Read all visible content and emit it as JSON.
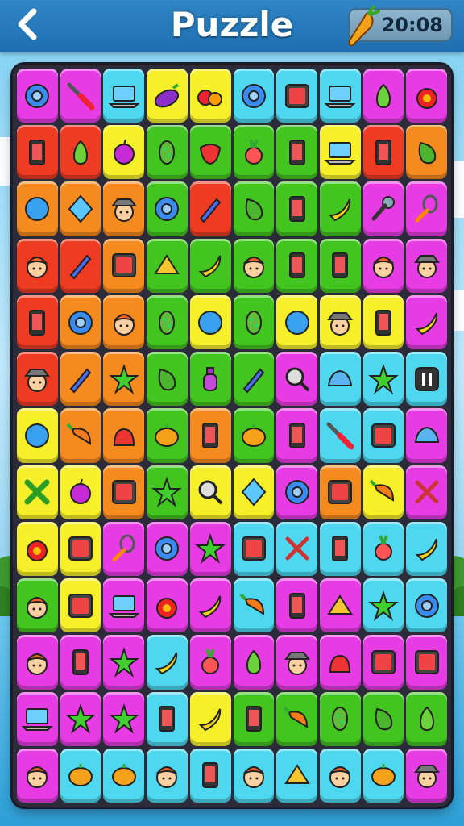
{
  "header": {
    "back_icon": "back-arrow-icon",
    "title": "Puzzle",
    "timer_icon": "carrot-icon",
    "timer": "20:08"
  },
  "colors": {
    "magenta": "#e73ce3",
    "cyan": "#4ed8f0",
    "yellow": "#f6f02a",
    "green": "#43c51f",
    "red": "#ee3b22",
    "orange": "#f58a1e",
    "lime": "#9be53a"
  },
  "board": {
    "rows": [
      [
        {
          "c": "magenta",
          "i": "ring-icon"
        },
        {
          "c": "magenta",
          "i": "screwdriver-icon"
        },
        {
          "c": "cyan",
          "i": "laptop-icon"
        },
        {
          "c": "yellow",
          "i": "eggplant-icon"
        },
        {
          "c": "yellow",
          "i": "fruit-pair-icon"
        },
        {
          "c": "cyan",
          "i": "ring-icon"
        },
        {
          "c": "cyan",
          "i": "tablet-icon"
        },
        {
          "c": "cyan",
          "i": "laptop-icon"
        },
        {
          "c": "magenta",
          "i": "pear-icon"
        },
        {
          "c": "magenta",
          "i": "tomato-icon"
        }
      ],
      [
        {
          "c": "red",
          "i": "phone-icon"
        },
        {
          "c": "red",
          "i": "pear-icon"
        },
        {
          "c": "yellow",
          "i": "plum-icon"
        },
        {
          "c": "green",
          "i": "pickle-icon"
        },
        {
          "c": "green",
          "i": "strawberry-icon"
        },
        {
          "c": "green",
          "i": "radish-icon"
        },
        {
          "c": "green",
          "i": "phone-icon"
        },
        {
          "c": "yellow",
          "i": "laptop-icon"
        },
        {
          "c": "red",
          "i": "phone-icon"
        },
        {
          "c": "orange",
          "i": "pepper-icon"
        }
      ],
      [
        {
          "c": "orange",
          "i": "ball-icon"
        },
        {
          "c": "orange",
          "i": "diamond-icon"
        },
        {
          "c": "orange",
          "i": "face-hat-icon"
        },
        {
          "c": "green",
          "i": "ring-icon"
        },
        {
          "c": "red",
          "i": "pencil-icon"
        },
        {
          "c": "green",
          "i": "pepper-icon"
        },
        {
          "c": "green",
          "i": "phone-icon"
        },
        {
          "c": "green",
          "i": "banana-icon"
        },
        {
          "c": "magenta",
          "i": "microphone-icon"
        },
        {
          "c": "magenta",
          "i": "whisk-icon"
        }
      ],
      [
        {
          "c": "red",
          "i": "face-icon"
        },
        {
          "c": "red",
          "i": "pencil-icon"
        },
        {
          "c": "orange",
          "i": "tablet-icon"
        },
        {
          "c": "green",
          "i": "cheese-icon"
        },
        {
          "c": "green",
          "i": "banana-icon"
        },
        {
          "c": "green",
          "i": "face-icon"
        },
        {
          "c": "green",
          "i": "phone-icon"
        },
        {
          "c": "green",
          "i": "phone-icon"
        },
        {
          "c": "magenta",
          "i": "face-icon"
        },
        {
          "c": "magenta",
          "i": "face-hat-icon"
        }
      ],
      [
        {
          "c": "red",
          "i": "phone-icon"
        },
        {
          "c": "orange",
          "i": "ring-icon"
        },
        {
          "c": "orange",
          "i": "face-icon"
        },
        {
          "c": "green",
          "i": "pickle-icon"
        },
        {
          "c": "yellow",
          "i": "ball-icon"
        },
        {
          "c": "green",
          "i": "pickle-icon"
        },
        {
          "c": "yellow",
          "i": "ball-icon"
        },
        {
          "c": "yellow",
          "i": "face-hat-icon"
        },
        {
          "c": "yellow",
          "i": "phone-icon"
        },
        {
          "c": "magenta",
          "i": "banana-icon"
        }
      ],
      [
        {
          "c": "red",
          "i": "face-hat-icon"
        },
        {
          "c": "orange",
          "i": "pencil-icon"
        },
        {
          "c": "orange",
          "i": "star-icon"
        },
        {
          "c": "green",
          "i": "pepper-icon"
        },
        {
          "c": "green",
          "i": "bottle-icon"
        },
        {
          "c": "green",
          "i": "pencil-icon"
        },
        {
          "c": "magenta",
          "i": "magnifier-icon"
        },
        {
          "c": "cyan",
          "i": "blob-icon"
        },
        {
          "c": "cyan",
          "i": "star-icon"
        },
        {
          "c": "cyan",
          "i": "pause-icon"
        }
      ],
      [
        {
          "c": "yellow",
          "i": "ball-icon"
        },
        {
          "c": "orange",
          "i": "carrot-icon"
        },
        {
          "c": "orange",
          "i": "bag-icon"
        },
        {
          "c": "green",
          "i": "pumpkin-icon"
        },
        {
          "c": "orange",
          "i": "phone-icon"
        },
        {
          "c": "green",
          "i": "pumpkin-icon"
        },
        {
          "c": "magenta",
          "i": "phone-icon"
        },
        {
          "c": "cyan",
          "i": "screwdriver-icon"
        },
        {
          "c": "cyan",
          "i": "tablet-icon"
        },
        {
          "c": "magenta",
          "i": "blob-icon"
        }
      ],
      [
        {
          "c": "yellow",
          "i": "cross-icon"
        },
        {
          "c": "yellow",
          "i": "plum-icon"
        },
        {
          "c": "orange",
          "i": "tablet-icon"
        },
        {
          "c": "green",
          "i": "star-icon"
        },
        {
          "c": "yellow",
          "i": "magnifier-icon"
        },
        {
          "c": "yellow",
          "i": "diamond-icon"
        },
        {
          "c": "magenta",
          "i": "ring-icon"
        },
        {
          "c": "orange",
          "i": "tablet-icon"
        },
        {
          "c": "yellow",
          "i": "carrot-icon"
        },
        {
          "c": "magenta",
          "i": "tools-icon"
        }
      ],
      [
        {
          "c": "yellow",
          "i": "tomato-icon"
        },
        {
          "c": "yellow",
          "i": "tablet-icon"
        },
        {
          "c": "magenta",
          "i": "whisk-icon"
        },
        {
          "c": "magenta",
          "i": "ring-icon"
        },
        {
          "c": "magenta",
          "i": "star-icon"
        },
        {
          "c": "cyan",
          "i": "tablet-icon"
        },
        {
          "c": "cyan",
          "i": "tools-icon"
        },
        {
          "c": "cyan",
          "i": "phone-icon"
        },
        {
          "c": "cyan",
          "i": "radish-icon"
        },
        {
          "c": "cyan",
          "i": "banana-icon"
        }
      ],
      [
        {
          "c": "green",
          "i": "face-icon"
        },
        {
          "c": "yellow",
          "i": "tablet-icon"
        },
        {
          "c": "magenta",
          "i": "laptop-icon"
        },
        {
          "c": "magenta",
          "i": "tomato-icon"
        },
        {
          "c": "magenta",
          "i": "banana-icon"
        },
        {
          "c": "cyan",
          "i": "carrot-icon"
        },
        {
          "c": "magenta",
          "i": "phone-icon"
        },
        {
          "c": "magenta",
          "i": "cheese-icon"
        },
        {
          "c": "cyan",
          "i": "star-icon"
        },
        {
          "c": "cyan",
          "i": "ring-icon"
        }
      ],
      [
        {
          "c": "magenta",
          "i": "face-icon"
        },
        {
          "c": "magenta",
          "i": "phone-icon"
        },
        {
          "c": "magenta",
          "i": "star-icon"
        },
        {
          "c": "cyan",
          "i": "banana-icon"
        },
        {
          "c": "magenta",
          "i": "radish-icon"
        },
        {
          "c": "magenta",
          "i": "pear-icon"
        },
        {
          "c": "magenta",
          "i": "face-hat-icon"
        },
        {
          "c": "magenta",
          "i": "bag-icon"
        },
        {
          "c": "magenta",
          "i": "tablet-icon"
        },
        {
          "c": "magenta",
          "i": "tablet-icon"
        }
      ],
      [
        {
          "c": "magenta",
          "i": "laptop-icon"
        },
        {
          "c": "magenta",
          "i": "star-icon"
        },
        {
          "c": "magenta",
          "i": "star-icon"
        },
        {
          "c": "cyan",
          "i": "phone-icon"
        },
        {
          "c": "yellow",
          "i": "banana-icon"
        },
        {
          "c": "green",
          "i": "phone-icon"
        },
        {
          "c": "green",
          "i": "carrot-icon"
        },
        {
          "c": "green",
          "i": "pickle-icon"
        },
        {
          "c": "green",
          "i": "pepper-icon"
        },
        {
          "c": "green",
          "i": "pear-icon"
        }
      ],
      [
        {
          "c": "magenta",
          "i": "face-icon"
        },
        {
          "c": "cyan",
          "i": "pumpkin-icon"
        },
        {
          "c": "cyan",
          "i": "pumpkin-icon"
        },
        {
          "c": "cyan",
          "i": "face-icon"
        },
        {
          "c": "cyan",
          "i": "phone-icon"
        },
        {
          "c": "cyan",
          "i": "face-icon"
        },
        {
          "c": "cyan",
          "i": "cheese-icon"
        },
        {
          "c": "cyan",
          "i": "face-icon"
        },
        {
          "c": "cyan",
          "i": "pumpkin-icon"
        },
        {
          "c": "magenta",
          "i": "face-hat-icon"
        }
      ]
    ]
  }
}
